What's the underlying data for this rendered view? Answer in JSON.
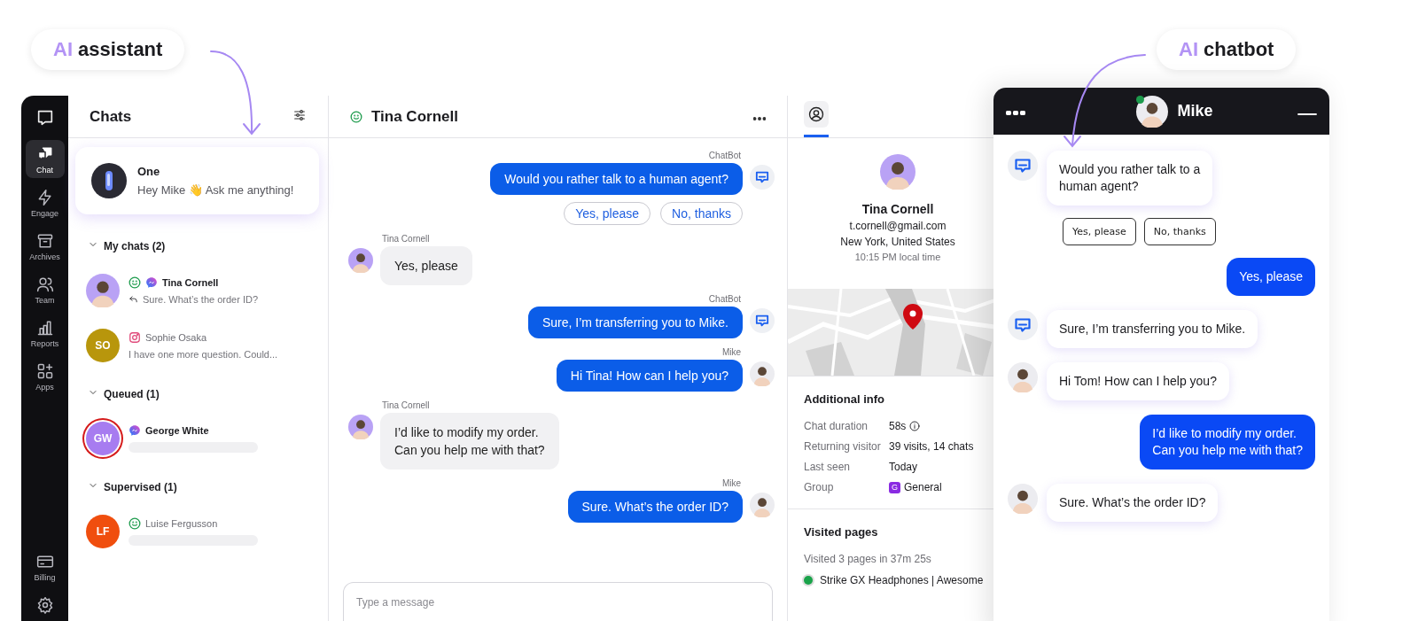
{
  "callouts": [
    {
      "accent": "AI",
      "text": "assistant"
    },
    {
      "accent": "AI",
      "text": "chatbot"
    }
  ],
  "nav": {
    "items": [
      {
        "kind": "chat",
        "label": "Chat",
        "selected": true
      },
      {
        "kind": "engage",
        "label": "Engage",
        "selected": false
      },
      {
        "kind": "archives",
        "label": "Archives",
        "selected": false
      },
      {
        "kind": "team",
        "label": "Team",
        "selected": false
      },
      {
        "kind": "reports",
        "label": "Reports",
        "selected": false
      },
      {
        "kind": "apps",
        "label": "Apps",
        "selected": false
      }
    ],
    "bottom_items": [
      {
        "kind": "billing",
        "label": "Billing"
      },
      {
        "kind": "settings"
      }
    ]
  },
  "chats_panel": {
    "title": "Chats",
    "assistant": {
      "name": "One",
      "greeting": "Hey Mike 👋 Ask me anything!"
    },
    "sections": [
      {
        "title": "My chats (2)",
        "expanded": true,
        "chats": [
          {
            "name": "Tina Cornell",
            "preview": "Sure. What’s the order ID?",
            "unread": true,
            "replied": true,
            "active": true,
            "kind": "messenger"
          },
          {
            "name": "Sophie Osaka",
            "preview": "I have one more question. Could...",
            "unread": false,
            "replied": false,
            "active": false,
            "kind": "instagram",
            "avatar": {
              "kind": "initials",
              "initials": "SO",
              "color": "#b8960c"
            }
          }
        ]
      },
      {
        "title": "Queued (1)",
        "expanded": true,
        "chats": [
          {
            "name": "George White",
            "unread": true,
            "replied": false,
            "active": false,
            "waiting": true,
            "kind": "messenger",
            "avatar": {
              "kind": "initials",
              "initials": "GW",
              "color": "#a77cf0"
            }
          }
        ]
      },
      {
        "title": "Supervised (1)",
        "expanded": true,
        "chats": [
          {
            "name": "Luise  Fergusson",
            "unread": false,
            "replied": false,
            "active": true,
            "kind": "direct",
            "avatar": {
              "kind": "initials",
              "initials": "LF",
              "color": "#f04e0e"
            }
          }
        ]
      }
    ]
  },
  "conversation": {
    "contact": "Tina Cornell",
    "online": true,
    "messages": [
      {
        "kind": "bot",
        "author": "ChatBot",
        "text": "Would you rather talk to a human agent?",
        "quick_replies": [
          "Yes, please",
          "No, thanks"
        ]
      },
      {
        "kind": "visitor",
        "author": "Tina Cornell",
        "text": "Yes, please"
      },
      {
        "kind": "bot",
        "author": "ChatBot",
        "text": "Sure, I’m transferring you to Mike."
      },
      {
        "kind": "agent",
        "author": "Mike",
        "text": "Hi Tina! How can I help you?"
      },
      {
        "kind": "visitor",
        "author": "Tina Cornell",
        "text": "I’d like to modify my order.\nCan you help me with that?"
      },
      {
        "kind": "agent",
        "author": "Mike",
        "text": "Sure. What’s the order ID?"
      }
    ],
    "composer": {
      "placeholder": "Type a message"
    }
  },
  "profile": {
    "tabs": [
      {
        "kind": "profile",
        "selected": true
      }
    ],
    "name": "Tina Cornell",
    "email": "t.cornell@gmail.com",
    "location": "New York, United States",
    "local_time": "10:15 PM local time",
    "additional_info": {
      "title": "Additional info",
      "rows": [
        {
          "label": "Chat duration",
          "value": "58s",
          "info": true
        },
        {
          "label": "Returning visitor",
          "value": "39 visits, 14 chats"
        },
        {
          "label": "Last seen",
          "value": "Today"
        },
        {
          "label": "Group",
          "value": "General",
          "badge": "G"
        }
      ]
    },
    "visited_pages": {
      "title": "Visited pages",
      "summary": "Visited 3 pages in 37m 25s",
      "pages": [
        "Strike GX Headphones | Awesome"
      ]
    }
  },
  "widget": {
    "agent": "Mike",
    "online": true,
    "messages": [
      {
        "kind": "bot",
        "text": "Would you rather talk to a\nhuman agent?",
        "quick_replies": [
          "Yes, please",
          "No, thanks"
        ]
      },
      {
        "kind": "visitor",
        "text": "Yes, please"
      },
      {
        "kind": "bot",
        "text": "Sure, I’m transferring you to Mike."
      },
      {
        "kind": "agent",
        "text": "Hi Tom! How can I help you?"
      },
      {
        "kind": "visitor",
        "text": "I’d like to modify my order.\nCan you help me with that?"
      },
      {
        "kind": "agent",
        "text": "Sure. What’s the order ID?"
      }
    ]
  }
}
